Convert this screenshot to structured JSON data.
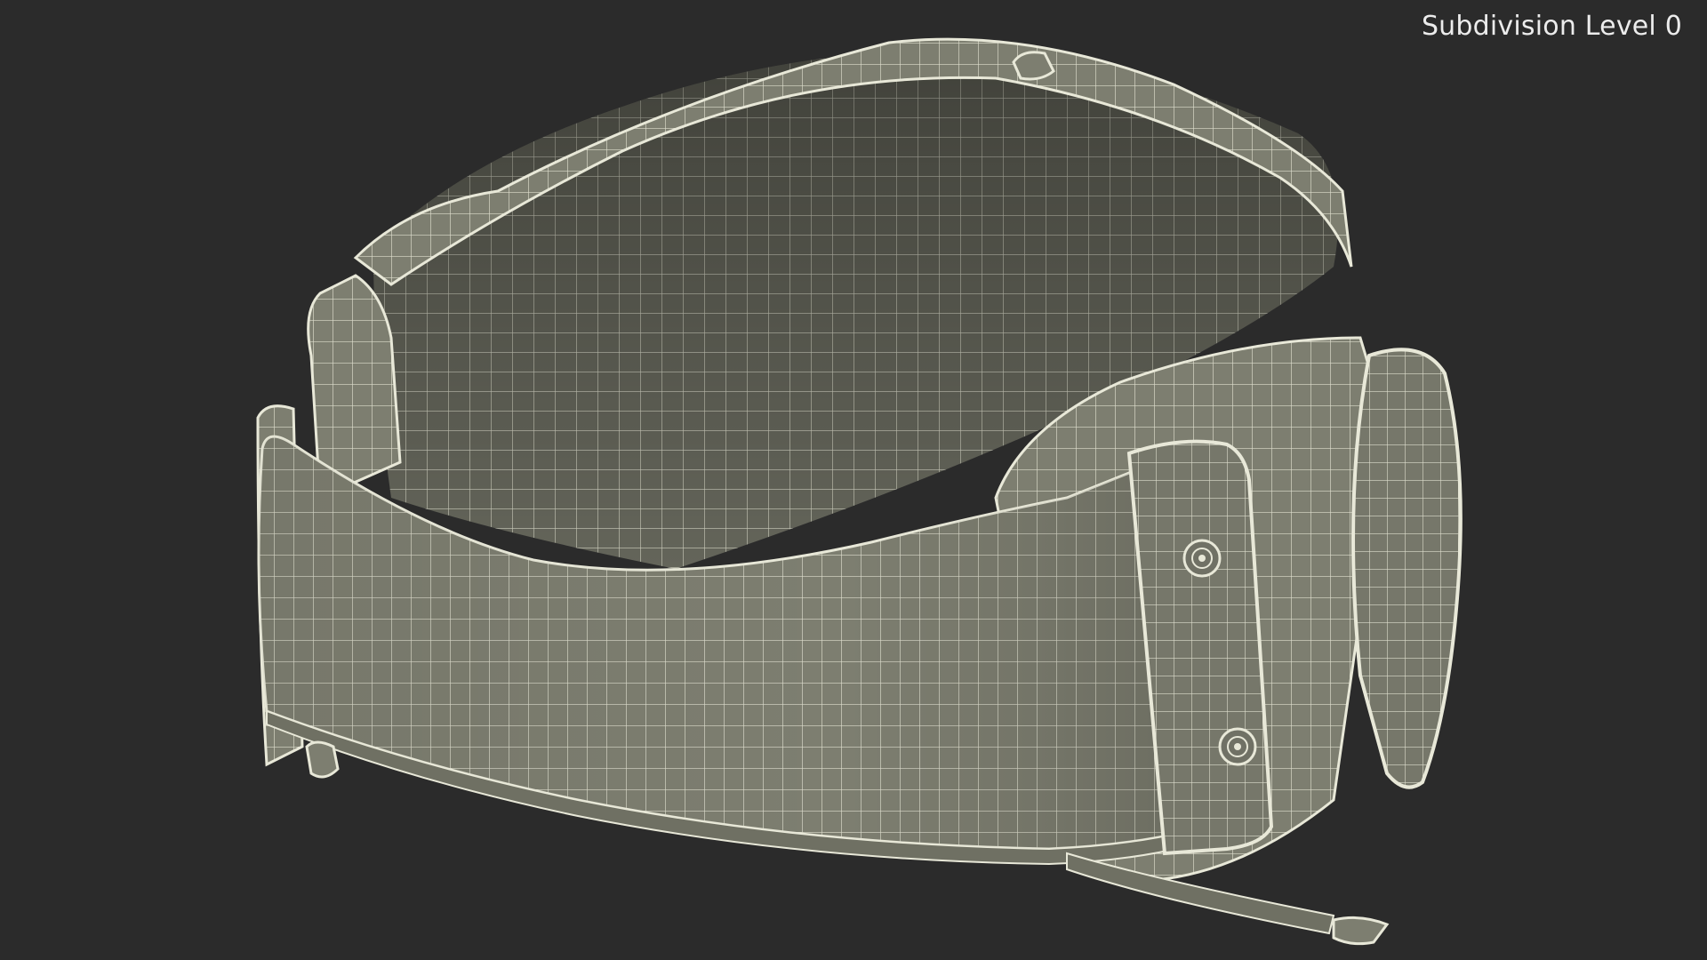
{
  "overlay": {
    "subdivision_label": "Subdivision Level 0"
  },
  "model": {
    "object": "lumbar back brace wireframe render",
    "shade_color": "#7d7e70",
    "wire_color": "#e8e8d8",
    "background_color": "#2b2b2b"
  }
}
